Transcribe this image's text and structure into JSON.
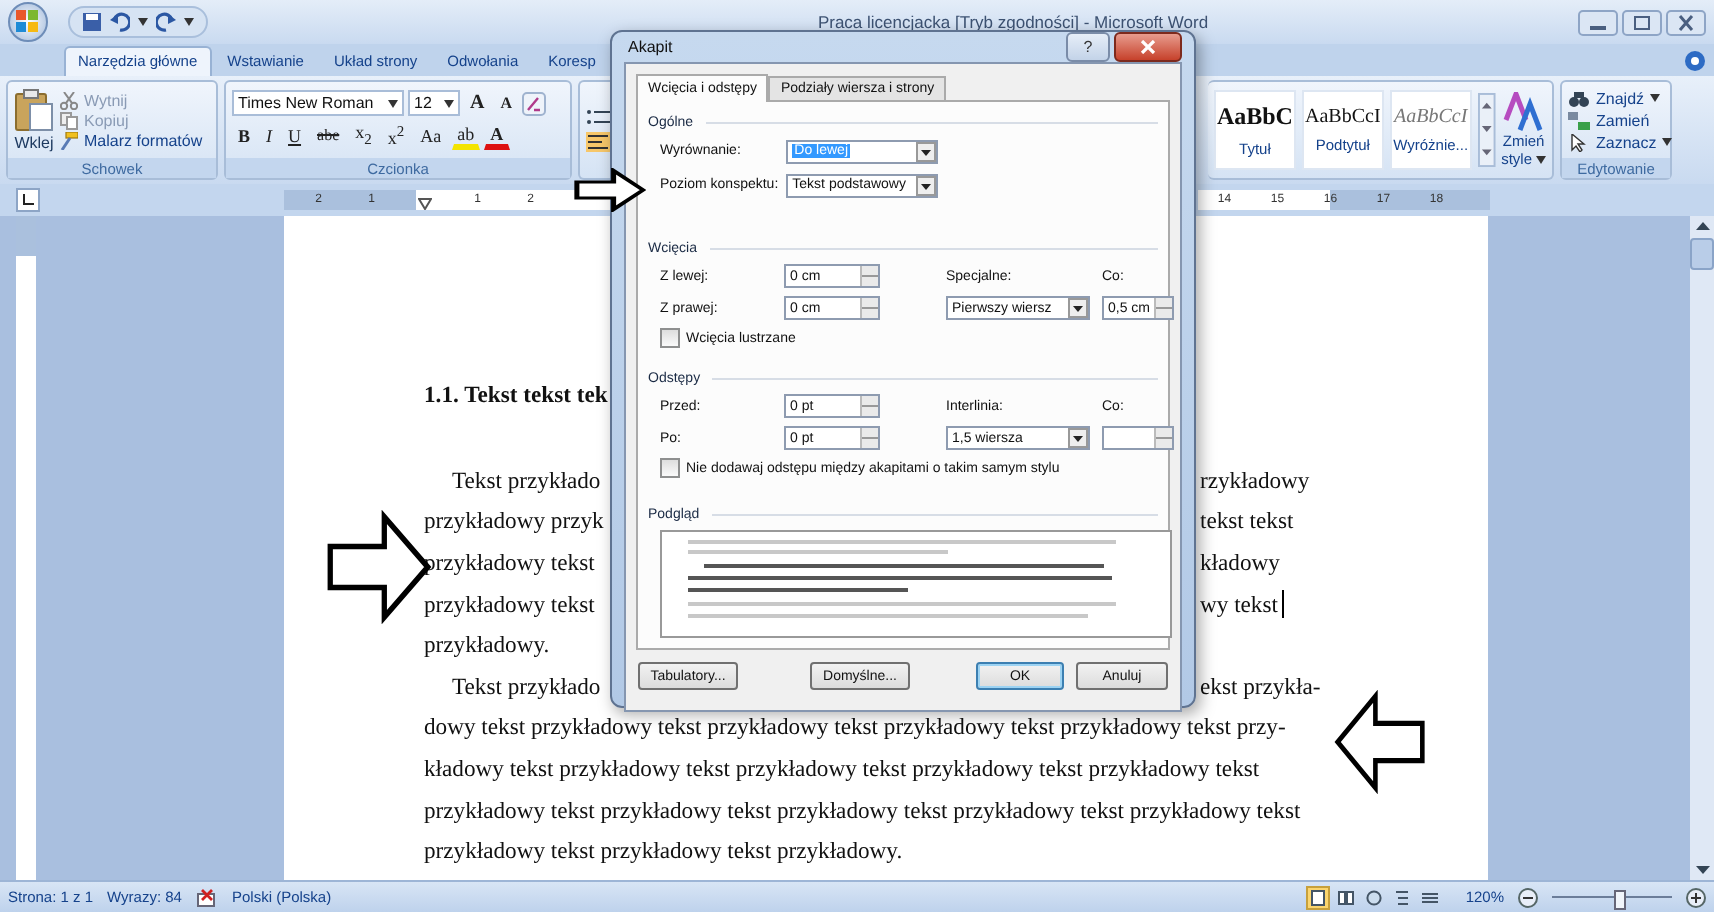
{
  "window": {
    "title": "Praca licencjacka [Tryb zgodności] - Microsoft Word"
  },
  "ribbon": {
    "tabs": [
      {
        "label": "Narzędzia główne",
        "selected": true
      },
      {
        "label": "Wstawianie",
        "selected": false
      },
      {
        "label": "Układ strony",
        "selected": false
      },
      {
        "label": "Odwołania",
        "selected": false
      },
      {
        "label": "Koresp",
        "selected": false
      }
    ],
    "clipboard": {
      "label": "Schowek",
      "paste": "Wklej",
      "items": [
        {
          "label": "Wytnij",
          "kind": "cut",
          "disabled": true
        },
        {
          "label": "Kopiuj",
          "kind": "copy",
          "disabled": true
        },
        {
          "label": "Malarz formatów",
          "kind": "painter",
          "disabled": false
        }
      ]
    },
    "font": {
      "label": "Czcionka",
      "name": "Times New Roman",
      "size": "12",
      "size_buttons": [
        {
          "label": "A",
          "kind": "grow"
        },
        {
          "label": "A",
          "kind": "shrink"
        }
      ],
      "buttons": [
        {
          "label": "B",
          "kind": "bold"
        },
        {
          "label": "I",
          "kind": "italic"
        },
        {
          "label": "U",
          "kind": "underline"
        },
        {
          "label": "abe",
          "kind": "strike"
        },
        {
          "label": "x$_{2}$",
          "kind": "sub"
        },
        {
          "label": "x$^{2}$",
          "kind": "sup"
        },
        {
          "label": "Aa",
          "kind": "case"
        },
        {
          "label": "ab",
          "kind": "highlight"
        },
        {
          "label": "A",
          "kind": "color"
        }
      ]
    },
    "styles": [
      {
        "sample": "AaBbC",
        "name": "Tytuł",
        "kind": "title"
      },
      {
        "sample": "AaBbCcI",
        "name": "Podtytuł",
        "kind": "subtitle"
      },
      {
        "sample": "AaBbCcI",
        "name": "Wyróżnie...",
        "kind": "emphasis"
      }
    ],
    "change_styles": {
      "line1": "Zmień",
      "line2": "style"
    },
    "editing": {
      "label": "Edytowanie",
      "items": [
        {
          "label": "Znajdź",
          "kind": "find",
          "dropdown": true
        },
        {
          "label": "Zamień",
          "kind": "replace",
          "dropdown": false
        },
        {
          "label": "Zaznacz",
          "kind": "select",
          "dropdown": true
        }
      ]
    }
  },
  "ruler": {
    "left_marks": [
      "2",
      "1",
      "1",
      "2"
    ],
    "right_marks": [
      "14",
      "15",
      "16",
      "17",
      "18"
    ]
  },
  "document": {
    "heading": "1.1. Tekst tekst tek",
    "lines": [
      {
        "left": "Tekst przykłado",
        "right": "rzykładowy",
        "indent": true,
        "cursor": false
      },
      {
        "left": "przykładowy przyk",
        "right": "tekst tekst",
        "indent": false,
        "cursor": false
      },
      {
        "left": "przykładowy tekst",
        "right": "kładowy",
        "indent": false,
        "cursor": false
      },
      {
        "left": "przykładowy tekst",
        "right": "wy tekst",
        "indent": false,
        "cursor": true
      },
      {
        "left": "przykładowy.",
        "indent": false,
        "cursor": false
      },
      {
        "left": "Tekst przykłado",
        "right": "ekst przykła-",
        "indent": true,
        "cursor": false
      },
      {
        "left": "dowy tekst przykładowy tekst przykładowy tekst przykładowy tekst przykładowy tekst przy-",
        "indent": false,
        "cursor": false
      },
      {
        "left": "kładowy tekst przykładowy tekst przykładowy tekst przykładowy tekst przykładowy tekst",
        "indent": false,
        "cursor": false
      },
      {
        "left": "przykładowy tekst przykładowy tekst przykładowy tekst przykładowy tekst przykładowy tekst",
        "indent": false,
        "cursor": false
      },
      {
        "left": "przykładowy tekst przykładowy tekst przykładowy.",
        "indent": false,
        "cursor": false
      }
    ]
  },
  "dialog": {
    "title": "Akapit",
    "help": "?",
    "tabs": [
      {
        "label": "Wcięcia i odstępy",
        "selected": true
      },
      {
        "label": "Podziały wiersza i strony",
        "selected": false
      }
    ],
    "general": {
      "heading": "Ogólne",
      "alignment": {
        "label": "Wyrównanie:",
        "value": "Do lewej",
        "focused": true
      },
      "outline": {
        "label": "Poziom konspektu:",
        "value": "Tekst podstawowy",
        "focused": false
      }
    },
    "indentation": {
      "heading": "Wcięcia",
      "left": {
        "label": "Z lewej:",
        "value": "0 cm"
      },
      "right": {
        "label": "Z prawej:",
        "value": "0 cm"
      },
      "special": {
        "label": "Specjalne:",
        "value": "Pierwszy wiersz"
      },
      "by": {
        "label": "Co:",
        "value": "0,5 cm"
      },
      "mirror": {
        "label": "Wcięcia lustrzane",
        "checked": false
      }
    },
    "spacing": {
      "heading": "Odstępy",
      "before": {
        "label": "Przed:",
        "value": "0 pt"
      },
      "after": {
        "label": "Po:",
        "value": "0 pt"
      },
      "line": {
        "label": "Interlinia:",
        "value": "1,5 wiersza"
      },
      "at": {
        "label": "Co:"
      },
      "no_space": {
        "label": "Nie dodawaj odstępu między akapitami o takim samym stylu",
        "checked": false
      }
    },
    "preview": {
      "heading": "Podgląd"
    },
    "buttons": [
      {
        "label": "Tabulatory...",
        "kind": "normal"
      },
      {
        "label": "Domyślne...",
        "kind": "normal"
      },
      {
        "label": "OK",
        "kind": "default"
      },
      {
        "label": "Anuluj",
        "kind": "normal"
      }
    ]
  },
  "status_bar": {
    "page": "Strona: 1 z 1",
    "words": "Wyrazy: 84",
    "language": "Polski (Polska)",
    "views": [
      {
        "kind": "print",
        "selected": true
      },
      {
        "kind": "read",
        "selected": false
      },
      {
        "kind": "web",
        "selected": false
      },
      {
        "kind": "outline",
        "selected": false
      },
      {
        "kind": "draft",
        "selected": false
      }
    ],
    "zoom": {
      "label": "120%",
      "level": 0.55
    }
  }
}
